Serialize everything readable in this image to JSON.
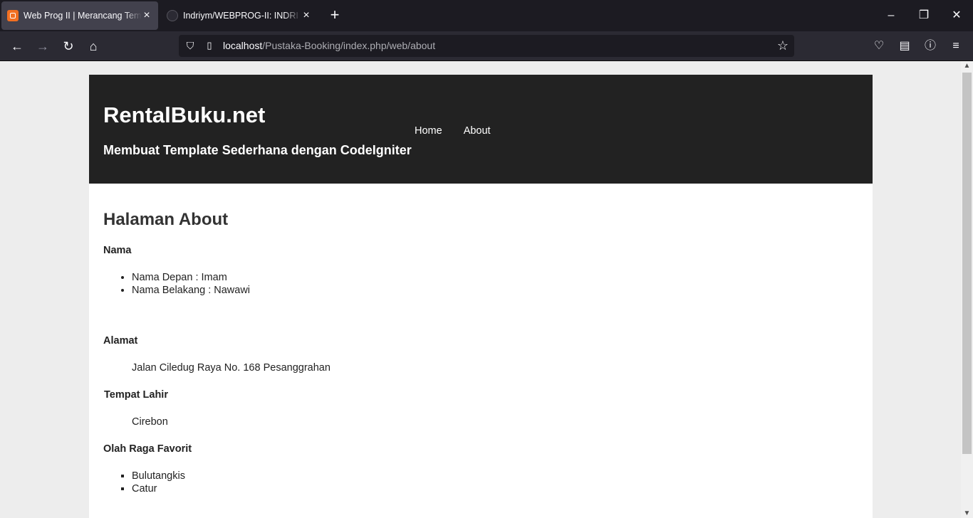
{
  "browser": {
    "tabs": [
      {
        "title": "Web Prog II | Merancang Template",
        "active": true
      },
      {
        "title": "Indriym/WEBPROG-II: INDRI YANI",
        "active": false
      }
    ],
    "new_tab_label": "+",
    "url": {
      "host": "localhost",
      "path": "/Pustaka-Booking/index.php/web/about"
    }
  },
  "site": {
    "title": "RentalBuku.net",
    "subtitle": "Membuat Template Sederhana dengan CodeIgniter",
    "nav": [
      {
        "label": "Home"
      },
      {
        "label": "About"
      }
    ]
  },
  "content": {
    "heading": "Halaman About",
    "nama": {
      "label": "Nama",
      "items": [
        "Nama Depan : Imam",
        "Nama Belakang : Nawawi"
      ]
    },
    "alamat": {
      "label": "Alamat",
      "value": "Jalan Ciledug Raya No. 168 Pesanggrahan"
    },
    "tempat_lahir": {
      "label": "Tempat Lahir",
      "value": "Cirebon"
    },
    "olahraga": {
      "label": "Olah Raga Favorit",
      "items": [
        "Bulutangkis",
        "Catur"
      ]
    }
  },
  "colors": {
    "tabbar_bg": "#1c1b22",
    "toolbar_bg": "#2b2a33",
    "header_bg": "#222222",
    "page_bg": "#ededed",
    "content_bg": "#ffffff"
  }
}
